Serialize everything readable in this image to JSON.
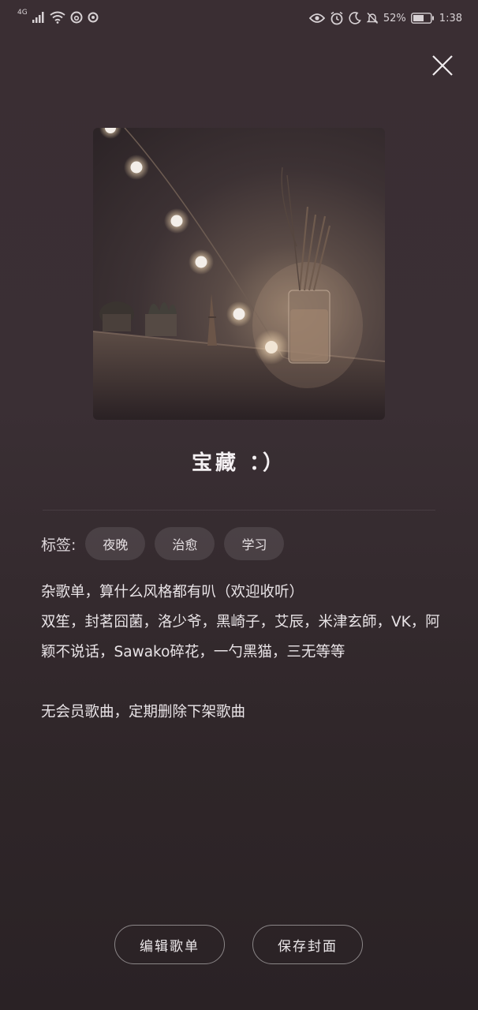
{
  "status_bar": {
    "network": "4G",
    "battery_percent": "52%",
    "time": "1:38"
  },
  "playlist": {
    "title": "宝藏 ：）",
    "tags_label": "标签:",
    "tags": [
      "夜晚",
      "治愈",
      "学习"
    ],
    "description": "杂歌单，算什么风格都有叭（欢迎收听）\n双笙，封茗囧菌，洛少爷，黑崎子，艾辰，米津玄師，VK，阿颖不说话，Sawako碎花，一勺黑猫，三无等等\n\n无会员歌曲，定期删除下架歌曲"
  },
  "actions": {
    "edit_label": "编辑歌单",
    "save_cover_label": "保存封面"
  }
}
